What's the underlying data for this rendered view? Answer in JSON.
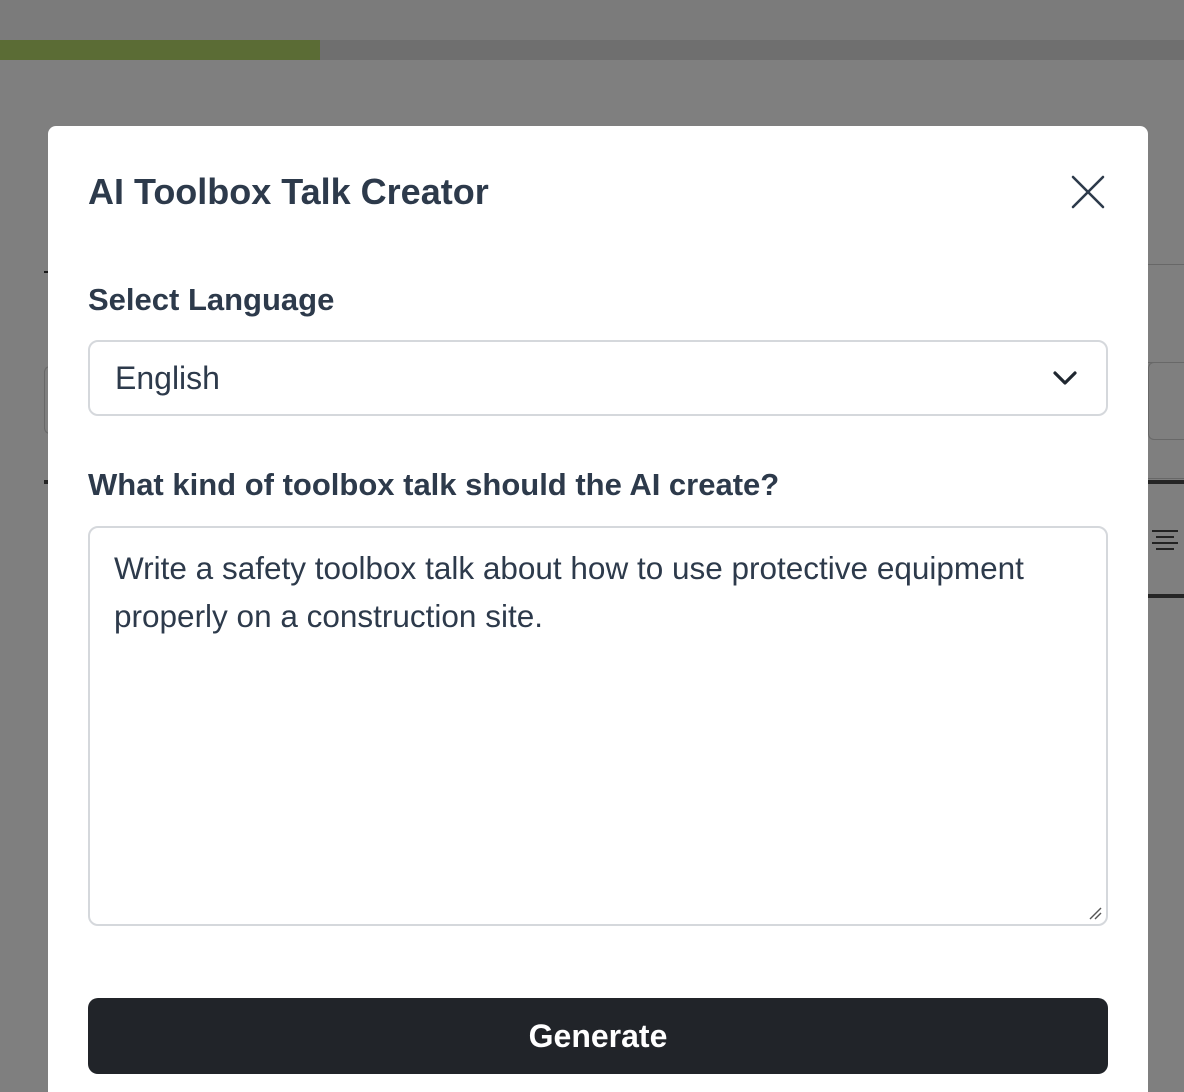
{
  "background": {
    "progress_fraction": 0.27,
    "progress_color": "#b6d96a"
  },
  "modal": {
    "title": "AI Toolbox Talk Creator",
    "close_icon": "close-icon",
    "language_label": "Select Language",
    "language_value": "English",
    "dropdown_icon": "chevron-down-icon",
    "prompt_label": "What kind of toolbox talk should the AI create?",
    "prompt_value": "Write a safety toolbox talk about how to use protective equipment properly on a construction site.",
    "generate_label": "Generate"
  },
  "colors": {
    "text": "#2d3a4b",
    "button_bg": "#212429",
    "button_text": "#ffffff",
    "border": "#d5d8dc",
    "overlay": "rgba(0,0,0,0.5)"
  }
}
